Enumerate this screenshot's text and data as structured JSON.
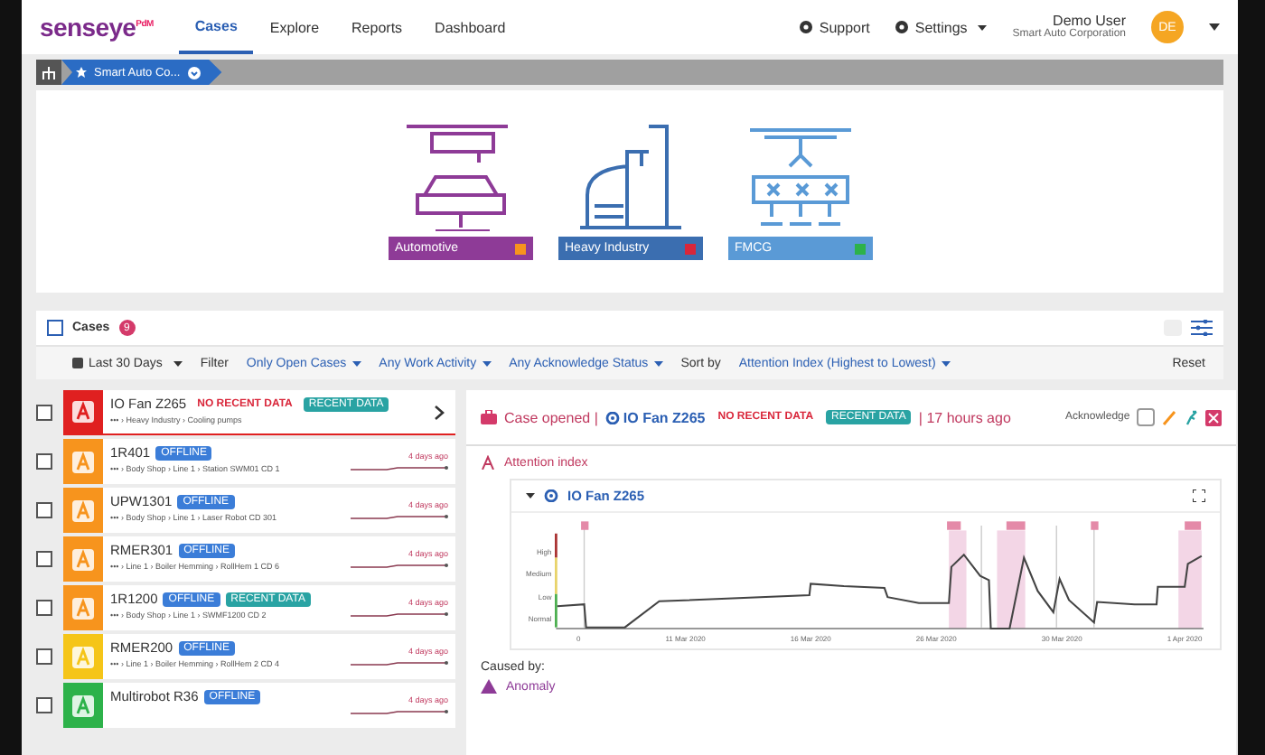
{
  "header": {
    "logo": "senseye",
    "logo_suffix": "PdM",
    "nav": [
      {
        "label": "Cases",
        "selected": true
      },
      {
        "label": "Explore",
        "selected": false
      },
      {
        "label": "Reports",
        "selected": false
      },
      {
        "label": "Dashboard",
        "selected": false
      }
    ],
    "support": "Support",
    "settings": "Settings",
    "user_name": "Demo User",
    "user_org": "Smart Auto Corporation",
    "avatar": "DE"
  },
  "breadcrumb": {
    "label": "Smart Auto Co..."
  },
  "industries": [
    {
      "kind": "automotive",
      "label": "Automotive",
      "color": "#f7941d"
    },
    {
      "kind": "heavy",
      "label": "Heavy Industry",
      "color": "#d9263a"
    },
    {
      "kind": "fmcg",
      "label": "FMCG",
      "color": "#2db24a"
    }
  ],
  "cases_bar": {
    "title": "Cases",
    "checked": false,
    "count": "9",
    "period": "Last 30 Days",
    "filter_label": "Filter",
    "filters": [
      "Only Open Cases",
      "Any Work Activity",
      "Any Acknowledge Status"
    ],
    "sort_label": "Sort by",
    "sort": "Attention Index (Highest to Lowest)",
    "reset": "Reset"
  },
  "cases": [
    {
      "title": "IO Fan Z265",
      "color": "#e02020",
      "selected": true,
      "checked": false,
      "badges": [
        {
          "kind": "alert",
          "text": "NO RECENT DATA"
        },
        {
          "kind": "info",
          "text": "RECENT DATA"
        }
      ],
      "path": "••• › Heavy Industry › Cooling pumps"
    },
    {
      "title": "1R401",
      "color": "#f7941d",
      "selected": false,
      "checked": false,
      "badges": [
        {
          "kind": "offline",
          "text": "OFFLINE"
        }
      ],
      "path": "••• › Body Shop › Line 1 › Station SWM01 CD 1",
      "ago": "4 days ago"
    },
    {
      "title": "UPW1301",
      "color": "#f7941d",
      "selected": false,
      "checked": false,
      "badges": [
        {
          "kind": "offline",
          "text": "OFFLINE"
        }
      ],
      "path": "••• › Body Shop › Line 1 › Laser Robot CD 301",
      "ago": "4 days ago"
    },
    {
      "title": "RMER301",
      "color": "#f7941d",
      "selected": false,
      "checked": false,
      "badges": [
        {
          "kind": "offline",
          "text": "OFFLINE"
        }
      ],
      "path": "••• › Line 1 › Boiler Hemming › RollHem 1 CD 6",
      "ago": "4 days ago"
    },
    {
      "title": "1R1200",
      "color": "#f7941d",
      "selected": false,
      "checked": false,
      "badges": [
        {
          "kind": "offline",
          "text": "OFFLINE"
        },
        {
          "kind": "info",
          "text": "RECENT DATA"
        }
      ],
      "path": "••• › Body Shop › Line 1 › SWMF1200 CD 2",
      "ago": "4 days ago"
    },
    {
      "title": "RMER200",
      "color": "#f5c518",
      "selected": false,
      "checked": false,
      "badges": [
        {
          "kind": "offline",
          "text": "OFFLINE"
        }
      ],
      "path": "••• › Line 1 › Boiler Hemming › RollHem 2 CD 4",
      "ago": "4 days ago"
    },
    {
      "title": "Multirobot R36",
      "color": "#2db24a",
      "selected": false,
      "checked": false,
      "badges": [
        {
          "kind": "offline",
          "text": "OFFLINE"
        }
      ],
      "ago": "4 days ago"
    }
  ],
  "detail": {
    "case_opened": "Case opened |",
    "asset": "IO Fan Z265",
    "badges": [
      {
        "kind": "alert",
        "text": "NO RECENT DATA"
      },
      {
        "kind": "info",
        "text": "RECENT DATA"
      }
    ],
    "ago": "| 17 hours ago",
    "acknowledge": "Acknowledge",
    "acknowledged": false,
    "section": "Attention index",
    "chart_title": "IO Fan Z265",
    "expanded": true,
    "y_labels": [
      "High",
      "Medium",
      "Low",
      "Normal"
    ],
    "x_labels": [
      "0",
      "11 Mar 2020",
      "16 Mar 2020",
      "26 Mar 2020",
      "30 Mar 2020",
      "1 Apr 2020"
    ],
    "caused_by": "Caused by:",
    "cause": "Anomaly"
  }
}
